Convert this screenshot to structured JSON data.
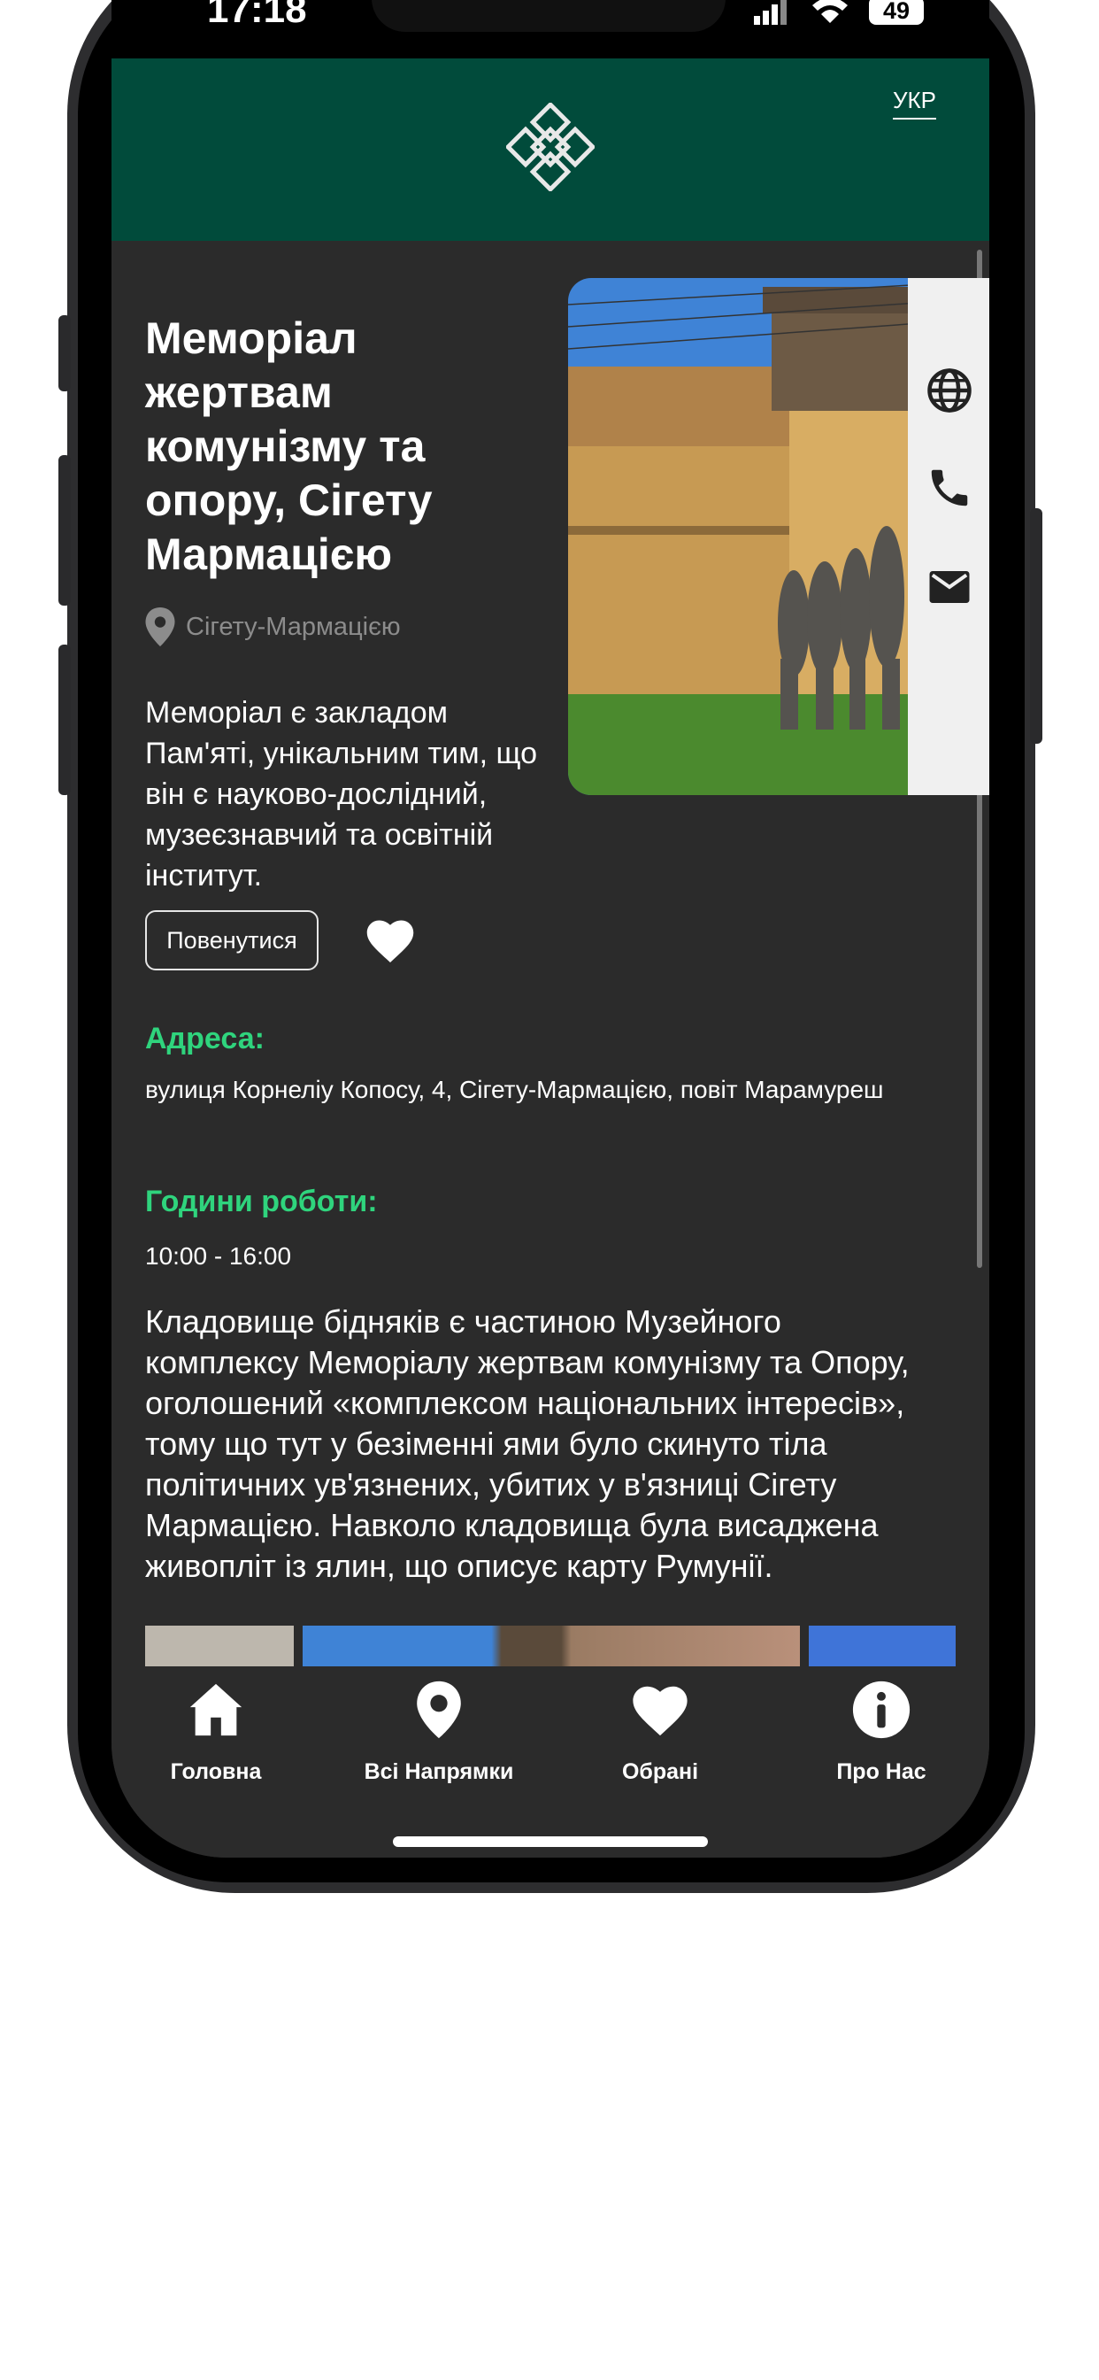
{
  "status_bar": {
    "time": "17:18",
    "battery": "49"
  },
  "header": {
    "language": "УКР"
  },
  "place": {
    "title": "Меморіал жертвам комунізму та опору, Сігету Мармацією",
    "location": "Сігету-Мармацією",
    "intro": "Меморіал є закладом Пам'яті, унікальним тим, що він є науково-дослідний, музеєзнавчий та освітній інститут."
  },
  "actions": {
    "back_label": "Повенутися"
  },
  "side_icons": [
    "globe-icon",
    "phone-icon",
    "mail-icon"
  ],
  "address": {
    "label": "Адреса:",
    "value": "вулиця Корнеліу Копосу, 4, Сігету-Мармацією, повіт Марамуреш"
  },
  "hours": {
    "label": "Години роботи:",
    "value": "10:00 - 16:00"
  },
  "description": "Кладовище бідняків є частиною Музейного комплексу Меморіалу жертвам комунізму та Опору, оголошений «комплексом національних інтересів», тому що тут у безіменні ями було скинуто тіла політичних ув'язнених, убитих у в'язниці Сігету Мармацією. Навколо кладовища була висаджена живопліт із ялин, що описує карту Румунії.",
  "tabs": [
    {
      "label": "Головна",
      "icon": "home-icon"
    },
    {
      "label": "Всі Напрямки",
      "icon": "location-pin-icon"
    },
    {
      "label": "Обрані",
      "icon": "heart-icon"
    },
    {
      "label": "Про Нас",
      "icon": "info-icon"
    }
  ],
  "colors": {
    "header": "#014b3b",
    "accent_green": "#2fd47d",
    "background": "#2b2b2b"
  }
}
